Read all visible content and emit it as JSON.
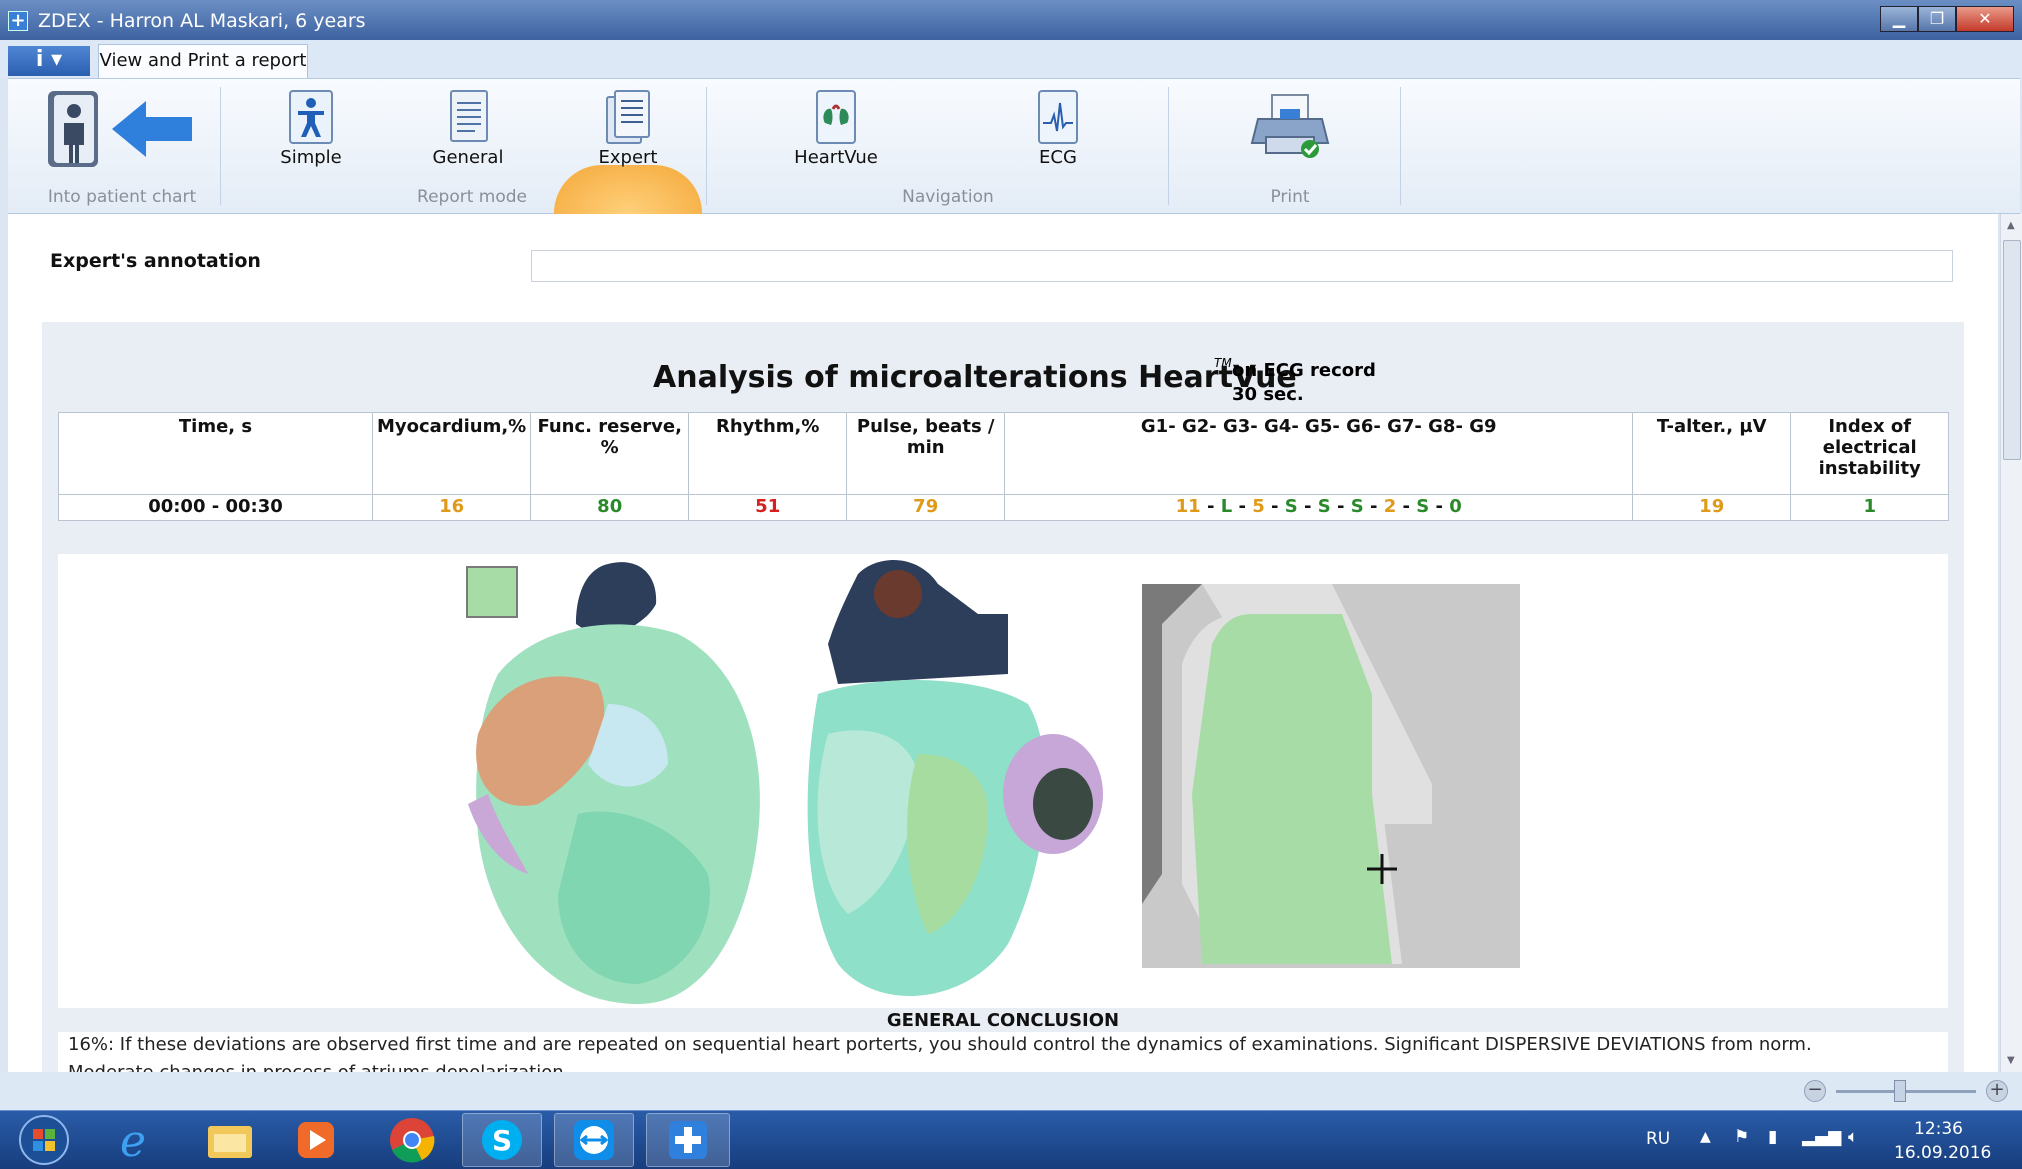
{
  "window": {
    "title": "ZDEX - Harron AL Maskari, 6 years"
  },
  "tabs": {
    "app_menu": "i ▾",
    "active_tab": "View and Print a report"
  },
  "ribbon": {
    "into_patient_chart": "Into patient chart",
    "simple": "Simple",
    "general": "General",
    "expert": "Expert",
    "report_mode": "Report mode",
    "heartvue": "HeartVue",
    "ecg": "ECG",
    "navigation": "Navigation",
    "print": "Print"
  },
  "annotation": {
    "label": "Expert's annotation",
    "value": ""
  },
  "analysis": {
    "title": "Analysis of microalterations HeartVue",
    "tm": "TM",
    "sub1": "on ECG record",
    "sub2": "30 sec."
  },
  "table": {
    "headers": [
      "Time, s",
      "Myocardium,%",
      "Func. reserve, %",
      "Rhythm,%",
      "Pulse, beats / min",
      "G1- G2- G3- G4- G5- G6- G7- G8- G9",
      "T-alter., µV",
      "Index of electrical instability"
    ],
    "row": {
      "time": "00:00 - 00:30",
      "myocardium": "16",
      "func_reserve": "80",
      "rhythm": "51",
      "pulse": "79",
      "g": [
        "11",
        "L",
        "5",
        "S",
        "S",
        "S",
        "2",
        "S",
        "0"
      ],
      "g_sep": " - ",
      "t_alter": "19",
      "index": "1"
    }
  },
  "conclusion": {
    "title": "GENERAL CONCLUSION",
    "line1": "16%:   If these deviations are observed first time and are repeated on sequential heart porterts, you should control the dynamics of examinations.      Significant DISPERSIVE DEVIATIONS from norm.",
    "line2": "Moderate changes in process of atriums depolarization"
  },
  "colors": {
    "orange": "#e09a1a",
    "green": "#2a8a2a",
    "red": "#d62020",
    "legend_green": "#a8dca6"
  },
  "taskbar": {
    "lang": "RU",
    "time": "12:36",
    "date": "16.09.2016",
    "apps": [
      "start-orb-icon",
      "internet-explorer-icon",
      "file-explorer-icon",
      "media-player-icon",
      "chrome-icon",
      "skype-icon",
      "teamviewer-icon",
      "zdex-app-icon"
    ]
  }
}
